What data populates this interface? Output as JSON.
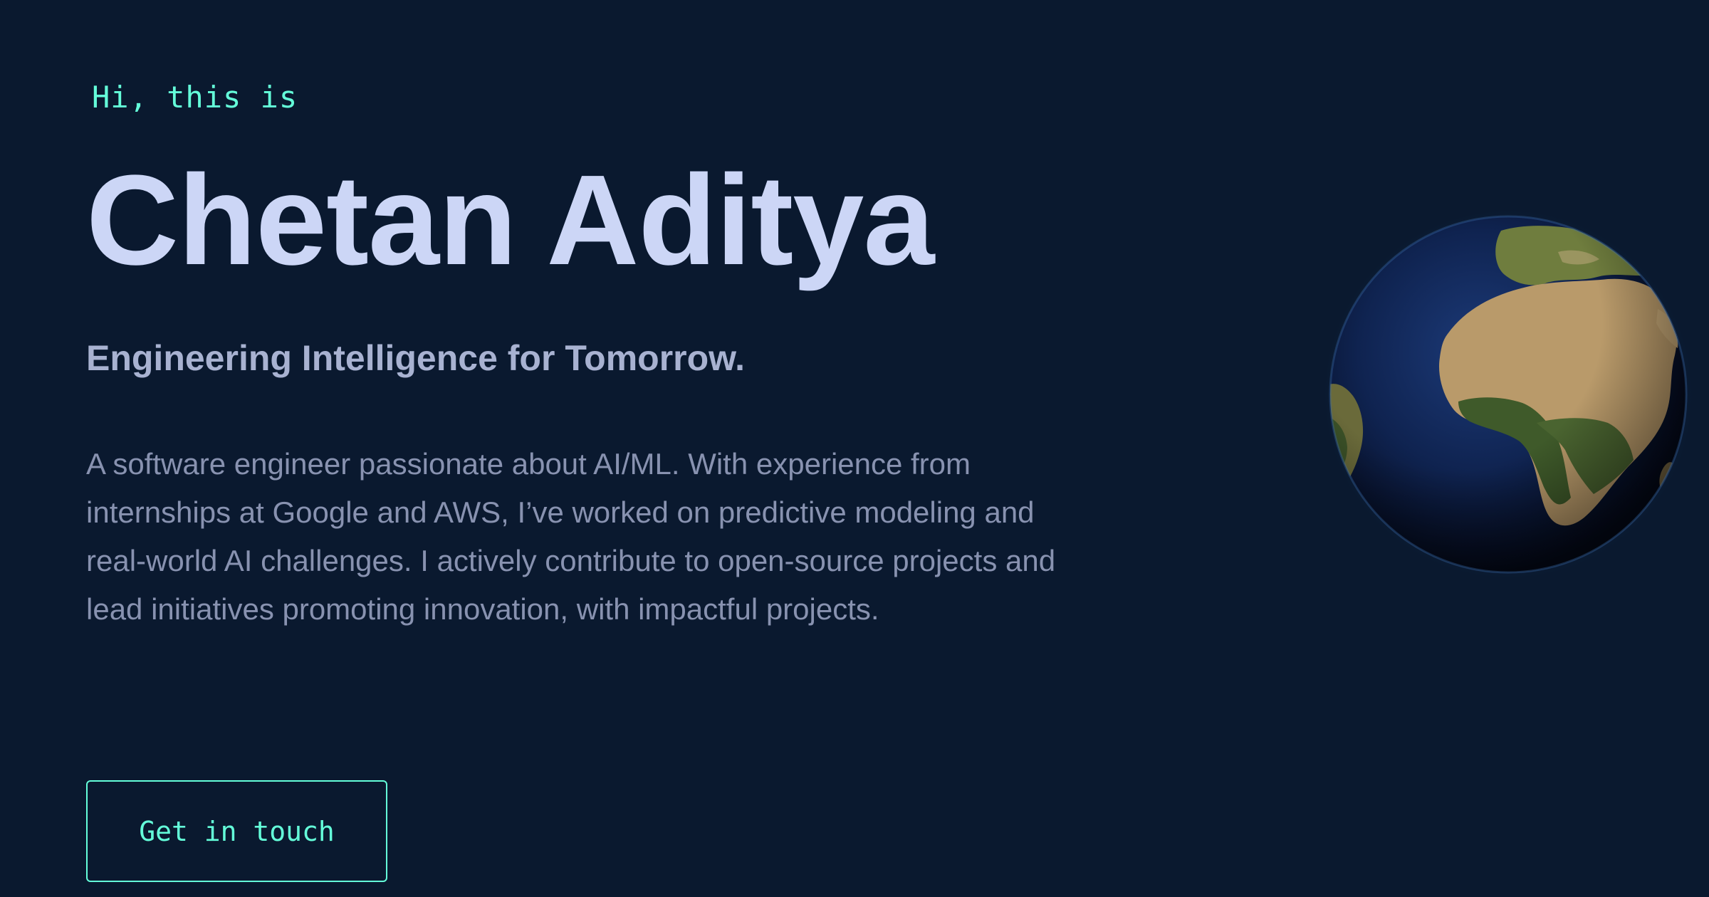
{
  "hero": {
    "greeting": "Hi, this is",
    "name": "Chetan Aditya",
    "tagline": "Engineering Intelligence for Tomorrow.",
    "bio": "A software engineer passionate about AI/ML. With experience from internships at Google and AWS, I’ve worked on predictive modeling and real-world AI challenges. I actively contribute to open-source projects and lead initiatives promoting innovation, with impactful projects.",
    "cta_label": "Get in touch"
  },
  "globe": {
    "icon": "earth-globe-icon"
  },
  "colors": {
    "background": "#0a192f",
    "accent": "#64ffda",
    "heading": "#ccd6f6",
    "tagline": "#a8b2d1",
    "body": "#8892b0"
  }
}
